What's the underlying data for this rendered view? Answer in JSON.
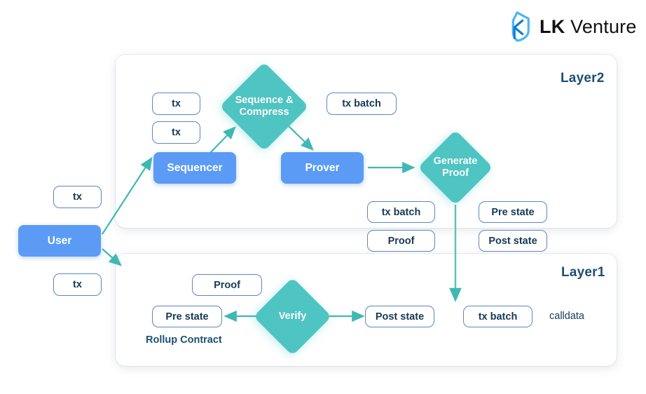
{
  "logo": {
    "mark_name": "lk-venture-logo-mark",
    "bold_part": "LK",
    "light_part": " Venture",
    "mark_color": "#1b9ae8",
    "text_color": "#111111"
  },
  "palette": {
    "panel_bg": "#ffffff",
    "page_bg": "#ffffff",
    "blue_box": "#5b9bf5",
    "teal_diamond": "#4ec5c3",
    "outline_border": "#5b87bf",
    "dark_text": "#163a54",
    "title_text": "#1b4f72",
    "arrow": "#3fb9b4"
  },
  "layer2": {
    "title": "Layer2",
    "nodes": {
      "tx_top": "tx",
      "tx_bottom": "tx",
      "sequencer": "Sequencer",
      "sequence_compress": "Sequence &\nCompress",
      "tx_batch": "tx batch",
      "prover": "Prover",
      "generate_proof": "Generate\nProof"
    }
  },
  "boundary": {
    "tx_batch": "tx batch",
    "proof": "Proof",
    "pre_state": "Pre state",
    "post_state": "Post state"
  },
  "layer1": {
    "title": "Layer1",
    "nodes": {
      "proof": "Proof",
      "pre_state": "Pre state",
      "verify": "Verify",
      "post_state": "Post state",
      "tx_batch": "tx batch"
    },
    "captions": {
      "rollup_contract": "Rollup Contract",
      "calldata": "calldata"
    }
  },
  "user_side": {
    "tx_top": "tx",
    "user": "User",
    "tx_bottom": "tx"
  }
}
